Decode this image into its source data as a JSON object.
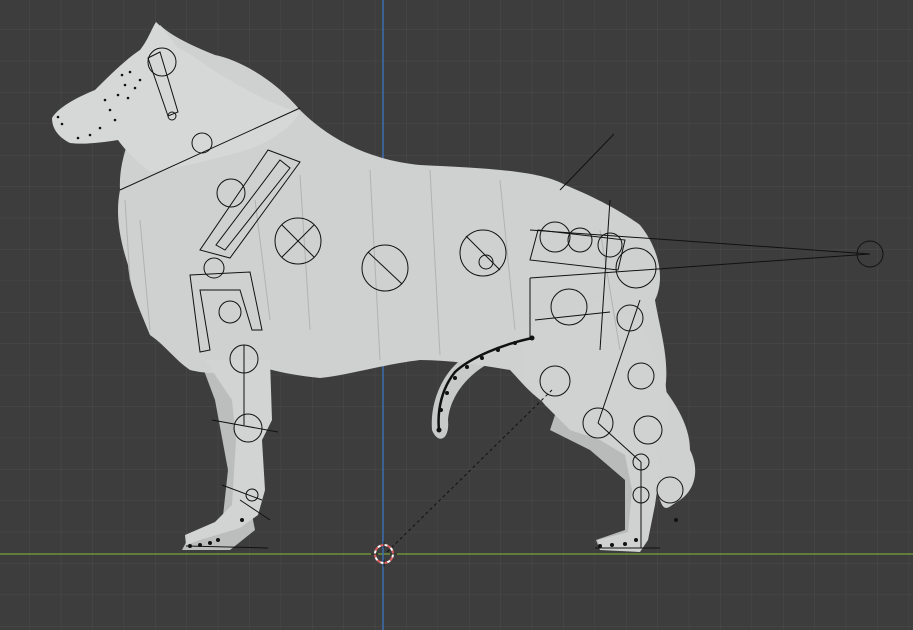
{
  "viewport": {
    "view": "orthographic-side",
    "background_color": "#3d3d3d",
    "grid_color": "#4a4a4a",
    "x_axis_color": "#7aa33a",
    "z_axis_color": "#3b6fb0"
  },
  "model": {
    "subject": "dog",
    "mesh_color": "#cfd0d0",
    "mesh_shadow_color": "#a9abab",
    "armature_color": "#000000"
  },
  "cursor": {
    "icon": "3d-cursor-icon",
    "ring_colors": [
      "#e06060",
      "#ffffff"
    ]
  }
}
